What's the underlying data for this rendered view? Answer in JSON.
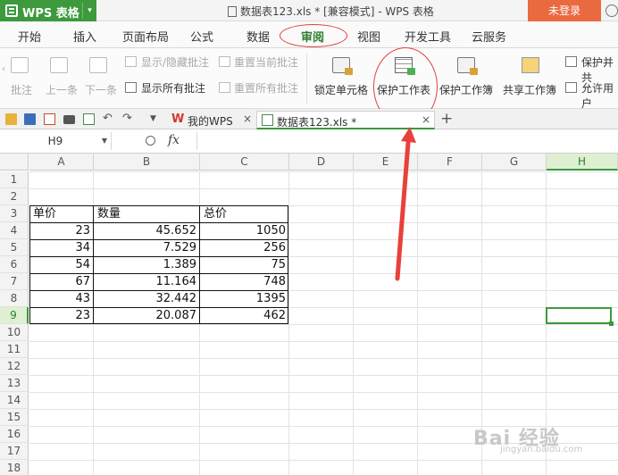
{
  "app": {
    "name": "WPS 表格",
    "caret": "▾"
  },
  "title": {
    "doc_title": "数据表123.xls * [兼容模式] - WPS 表格"
  },
  "login": {
    "label": "未登录"
  },
  "menu": {
    "tabs": [
      {
        "label": "开始"
      },
      {
        "label": "插入"
      },
      {
        "label": "页面布局"
      },
      {
        "label": "公式"
      },
      {
        "label": "数据"
      },
      {
        "label": "审阅"
      },
      {
        "label": "视图"
      },
      {
        "label": "开发工具"
      },
      {
        "label": "云服务"
      }
    ],
    "active": "审阅"
  },
  "ribbon": {
    "comment": "批注",
    "prev": "上一条",
    "next": "下一条",
    "show_hide_comments": "显示/隐藏批注",
    "show_all_comments": "显示所有批注",
    "reset_current_comment": "重置当前批注",
    "reset_all_comments": "重置所有批注",
    "lock_cell": "锁定单元格",
    "protect_sheet": "保护工作表",
    "protect_workbook": "保护工作簿",
    "share_workbook": "共享工作簿",
    "protect_share": "保护并共",
    "allow_users": "允许用户"
  },
  "doc_tabs": [
    {
      "label": "我的WPS",
      "close": "×"
    },
    {
      "label": "数据表123.xls *",
      "close": "×"
    }
  ],
  "add_tab": "+",
  "formula": {
    "cell_ref": "H9",
    "fx": "fx",
    "content": ""
  },
  "grid": {
    "columns": [
      "A",
      "B",
      "C",
      "D",
      "E",
      "F",
      "G",
      "H"
    ],
    "selected_column": "H",
    "rows": [
      "1",
      "2",
      "3",
      "4",
      "5",
      "6",
      "7",
      "8",
      "9",
      "10",
      "11",
      "12",
      "13",
      "14",
      "15",
      "16",
      "17",
      "18"
    ],
    "selected_row": "9",
    "headers": {
      "a3": "单价",
      "b3": "数量",
      "c3": "总价"
    },
    "data": [
      {
        "a": "23",
        "b": "45.652",
        "c": "1050"
      },
      {
        "a": "34",
        "b": "7.529",
        "c": "256"
      },
      {
        "a": "54",
        "b": "1.389",
        "c": "75"
      },
      {
        "a": "67",
        "b": "11.164",
        "c": "748"
      },
      {
        "a": "43",
        "b": "32.442",
        "c": "1395"
      },
      {
        "a": "23",
        "b": "20.087",
        "c": "462"
      }
    ]
  },
  "watermark": {
    "text": "Bai 经验",
    "sub": "jingyan.baidu.com"
  },
  "colors": {
    "accent": "#3c9a3c",
    "highlight": "#e0413a",
    "login": "#ea6a40"
  }
}
